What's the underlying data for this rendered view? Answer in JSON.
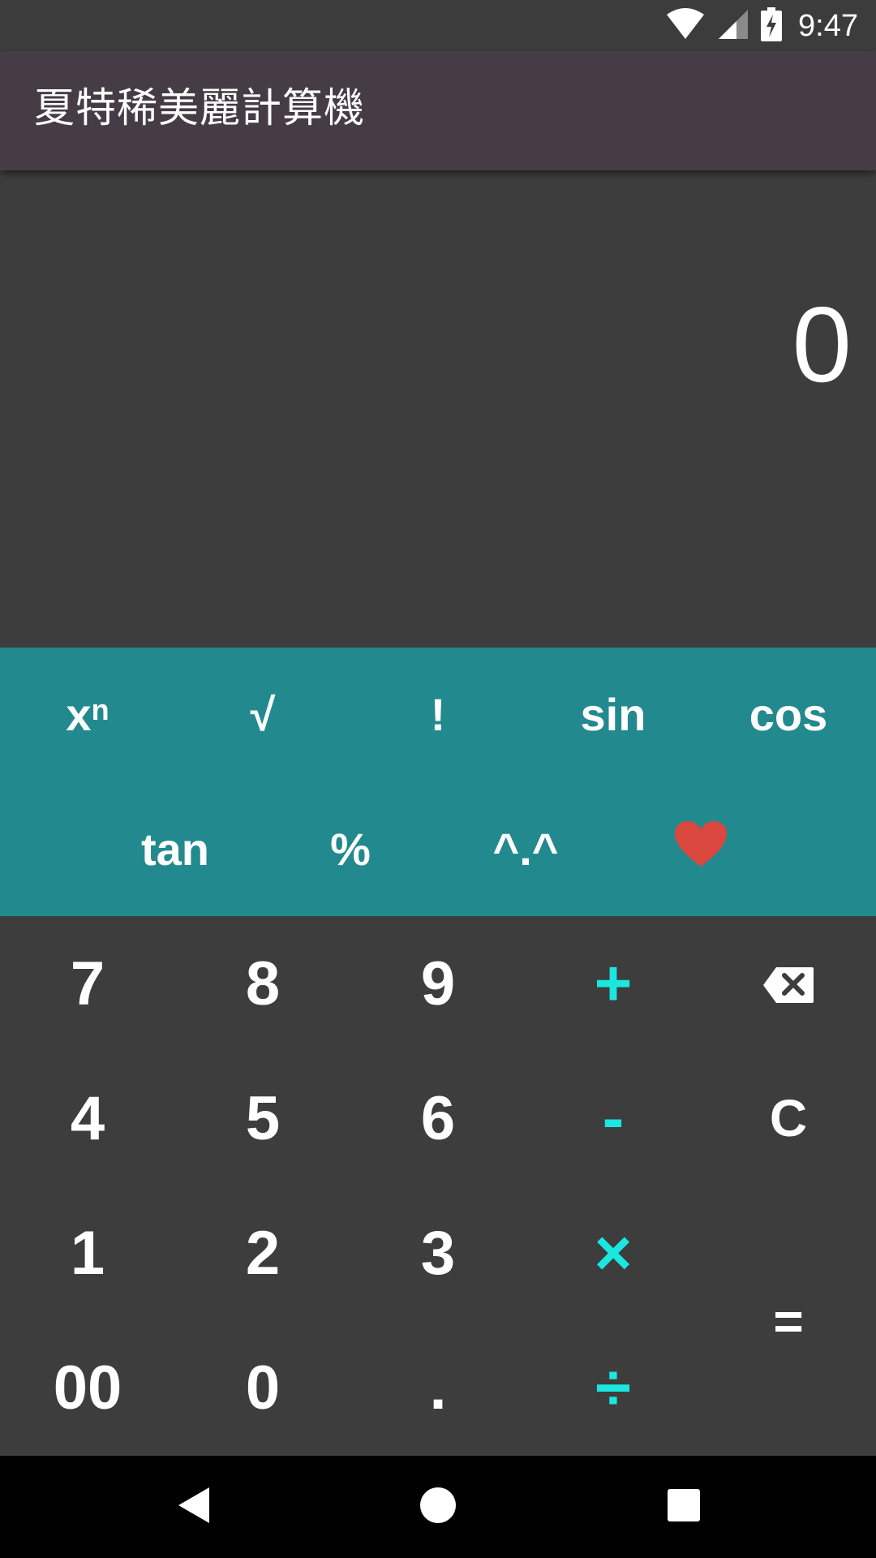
{
  "status_bar": {
    "time": "9:47",
    "icons": [
      "wifi-icon",
      "cell-signal-icon",
      "battery-charging-icon"
    ]
  },
  "app_bar": {
    "title": "夏特稀美麗計算機"
  },
  "display": {
    "value": "0"
  },
  "scientific_keys": {
    "power": {
      "base": "x",
      "exp": "n"
    },
    "sqrt": "√",
    "factorial": "!",
    "sin": "sin",
    "cos": "cos",
    "tan": "tan",
    "percent": "%",
    "smile": "^.^",
    "heart": "heart-icon"
  },
  "keys": {
    "k7": "7",
    "k8": "8",
    "k9": "9",
    "plus": "+",
    "backspace": "backspace-icon",
    "k4": "4",
    "k5": "5",
    "k6": "6",
    "minus": "-",
    "clear": "C",
    "k1": "1",
    "k2": "2",
    "k3": "3",
    "times": "×",
    "equals": "=",
    "k00": "00",
    "k0": "0",
    "dot": ".",
    "divide": "÷"
  },
  "nav_bar": {
    "icons": [
      "back-icon",
      "home-icon",
      "recents-icon"
    ]
  },
  "colors": {
    "accent": "#1ce6e0",
    "sci_panel": "#228a8f",
    "app_bar": "#463c45",
    "background": "#3d3d3d",
    "heart": "#d9473f"
  }
}
